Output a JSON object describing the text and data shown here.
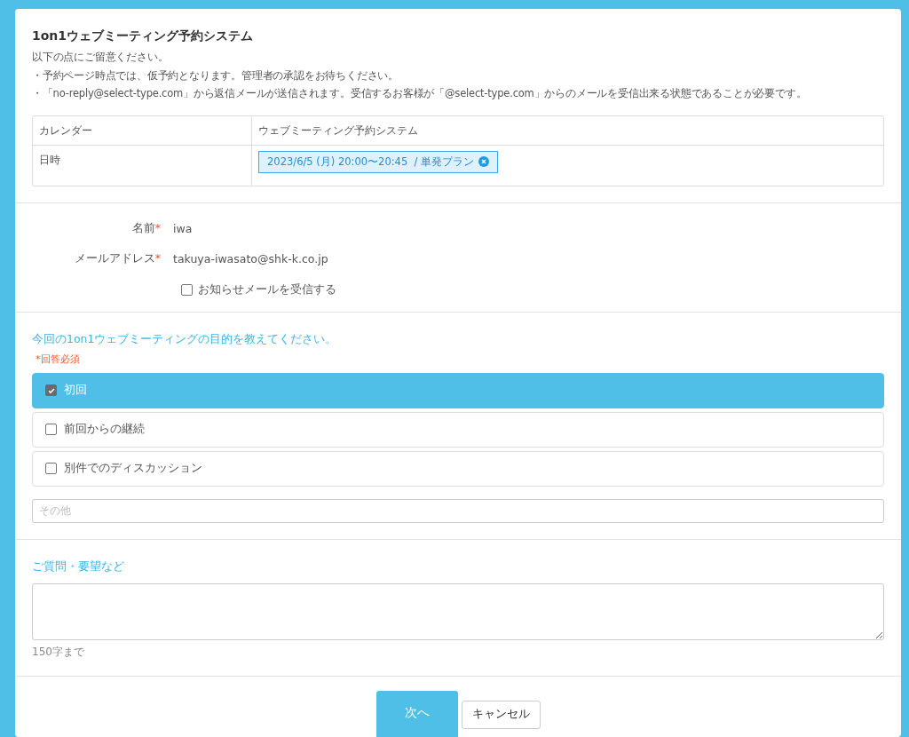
{
  "header": {
    "title": "1on1ウェブミーティング予約システム",
    "notes": [
      "以下の点にご留意ください。",
      "・予約ページ時点では、仮予約となります。管理者の承認をお待ちください。",
      "・「no-reply@select-type.com」から返信メールが送信されます。受信するお客様が「@select-type.com」からのメールを受信出来る状態であることが必要です。"
    ]
  },
  "summary": [
    {
      "label": "カレンダー",
      "value": "ウェブミーティング予約システム",
      "kind": "text"
    },
    {
      "label": "日時",
      "value": "2023/6/5 (月) 20:00〜20:45  / 単発プラン",
      "kind": "chip"
    }
  ],
  "fields": [
    {
      "label": "名前",
      "mark": "*",
      "value": "iwa"
    },
    {
      "label": "メールアドレス",
      "mark": "*",
      "value": "takuya-iwasato@shk-k.co.jp"
    }
  ],
  "newsletter": {
    "label": "お知らせメールを受信する",
    "checked": false
  },
  "question": {
    "title": "今回の1on1ウェブミーティングの目的を教えてください。",
    "required_note": "*回答必須",
    "options": [
      {
        "label": "初回",
        "checked": true
      },
      {
        "label": "前回からの継続",
        "checked": false
      },
      {
        "label": "別件でのディスカッション",
        "checked": false
      }
    ],
    "other_placeholder": "その他"
  },
  "comments": {
    "title": "ご質問・要望など",
    "hint": "150字まで"
  },
  "buttons": [
    {
      "label": "次へ",
      "kind": "primary"
    },
    {
      "label": "キャンセル",
      "kind": "secondary"
    }
  ]
}
